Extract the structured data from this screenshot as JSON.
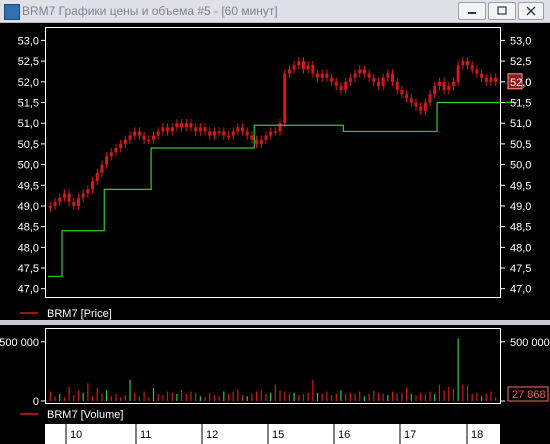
{
  "window": {
    "title": "BRM7 Графики цены и объема #5 - [60 минут]"
  },
  "colors": {
    "candle": "#d81818",
    "line": "#2ecc2e",
    "axis": "#ffffff",
    "price_badge": "#8b1c1c"
  },
  "chart_data": [
    {
      "type": "candlestick",
      "legend": "BRM7 [Price]",
      "ylim": [
        46.8,
        53.3
      ],
      "yticks": [
        "53,0",
        "52,5",
        "52,0",
        "51,5",
        "51,0",
        "50,5",
        "50,0",
        "49,5",
        "49,0",
        "48,5",
        "48,0",
        "47,5",
        "47,0"
      ],
      "ytick_values": [
        53.0,
        52.5,
        52.0,
        51.5,
        51.0,
        50.5,
        50.0,
        49.5,
        49.0,
        48.5,
        48.0,
        47.5,
        47.0
      ],
      "current_value_label": "52,0",
      "close": [
        49.0,
        49.1,
        49.2,
        49.3,
        49.1,
        49.0,
        49.2,
        49.3,
        49.4,
        49.6,
        49.8,
        50.0,
        50.2,
        50.3,
        50.4,
        50.5,
        50.6,
        50.7,
        50.8,
        50.7,
        50.6,
        50.6,
        50.7,
        50.8,
        50.9,
        50.8,
        50.9,
        51.0,
        50.9,
        51.0,
        50.9,
        50.8,
        50.9,
        50.8,
        50.7,
        50.8,
        50.8,
        50.7,
        50.7,
        50.8,
        50.9,
        50.8,
        50.7,
        50.6,
        50.5,
        50.6,
        50.7,
        50.8,
        50.8,
        51.0,
        52.2,
        52.3,
        52.4,
        52.5,
        52.3,
        52.4,
        52.2,
        52.1,
        52.2,
        52.1,
        52.0,
        51.9,
        51.8,
        52.0,
        52.1,
        52.2,
        52.3,
        52.2,
        52.1,
        52.0,
        51.9,
        52.1,
        52.2,
        52.0,
        51.8,
        51.7,
        51.6,
        51.5,
        51.4,
        51.3,
        51.5,
        51.7,
        51.9,
        52.0,
        51.8,
        51.9,
        52.0,
        52.4,
        52.5,
        52.4,
        52.3,
        52.2,
        52.1,
        52.0,
        52.1,
        52.0
      ],
      "step_line": [
        {
          "from": 0,
          "to": 3,
          "value": 47.3
        },
        {
          "from": 3,
          "to": 12,
          "value": 48.4
        },
        {
          "from": 12,
          "to": 22,
          "value": 49.4
        },
        {
          "from": 22,
          "to": 44,
          "value": 50.4
        },
        {
          "from": 44,
          "to": 63,
          "value": 50.95
        },
        {
          "from": 63,
          "to": 83,
          "value": 50.8
        },
        {
          "from": 83,
          "to": 100,
          "value": 51.5
        }
      ]
    },
    {
      "type": "bar",
      "legend": "BRM7 [Volume]",
      "ylim": [
        0,
        600000
      ],
      "yticks": [
        "500 000",
        "0"
      ],
      "ytick_values": [
        500000,
        0
      ],
      "current_value_label": "27 868",
      "values": [
        80000,
        40000,
        60000,
        30000,
        120000,
        50000,
        90000,
        70000,
        150000,
        40000,
        110000,
        60000,
        90000,
        40000,
        60000,
        30000,
        50000,
        180000,
        70000,
        40000,
        80000,
        30000,
        110000,
        60000,
        50000,
        80000,
        70000,
        60000,
        90000,
        60000,
        80000,
        70000,
        40000,
        30000,
        70000,
        50000,
        40000,
        80000,
        60000,
        80000,
        100000,
        50000,
        40000,
        60000,
        80000,
        90000,
        60000,
        70000,
        140000,
        90000,
        80000,
        60000,
        70000,
        50000,
        60000,
        70000,
        180000,
        70000,
        60000,
        80000,
        50000,
        60000,
        90000,
        60000,
        70000,
        60000,
        80000,
        40000,
        60000,
        90000,
        70000,
        60000,
        50000,
        80000,
        60000,
        70000,
        110000,
        60000,
        50000,
        70000,
        60000,
        80000,
        60000,
        140000,
        90000,
        120000,
        100000,
        530000,
        140000,
        130000,
        60000,
        70000,
        40000,
        60000,
        80000,
        30000
      ]
    }
  ],
  "time_axis": {
    "labels": [
      "10",
      "11",
      "12",
      "15",
      "16",
      "17",
      "18"
    ]
  }
}
